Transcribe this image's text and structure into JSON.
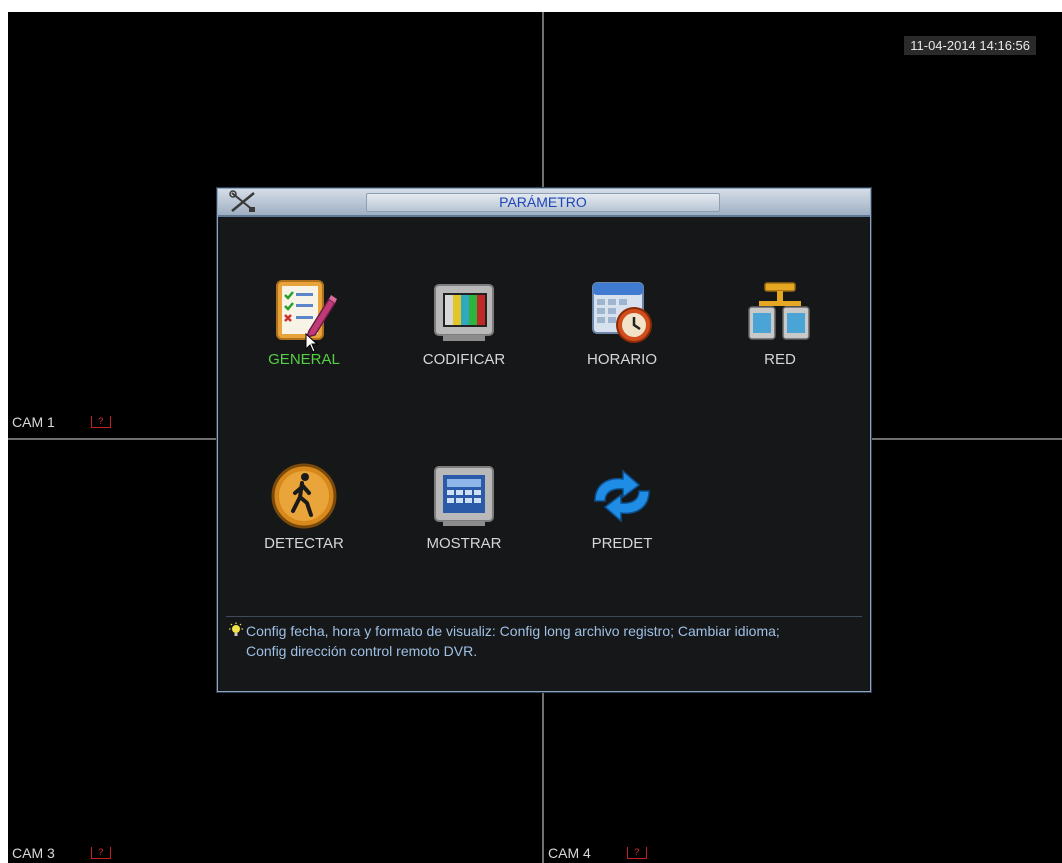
{
  "status": {
    "datetime": "11-04-2014 14:16:56"
  },
  "cameras": [
    {
      "label": "CAM 1",
      "rec": "?"
    },
    {
      "label": "CAM 3",
      "rec": "?"
    },
    {
      "label": "CAM 4",
      "rec": "?"
    }
  ],
  "dialog": {
    "title": "PARÁMETRO",
    "items": [
      {
        "label": "GENERAL",
        "icon": "general-checklist-icon",
        "active": true
      },
      {
        "label": "CODIFICAR",
        "icon": "encode-tv-icon"
      },
      {
        "label": "HORARIO",
        "icon": "schedule-calendar-clock-icon"
      },
      {
        "label": "RED",
        "icon": "network-icon"
      },
      {
        "label": "DETECTAR",
        "icon": "detect-person-icon"
      },
      {
        "label": "MOSTRAR",
        "icon": "display-monitor-icon"
      },
      {
        "label": "PREDET",
        "icon": "default-refresh-icon"
      }
    ],
    "hint_line1": "Config fecha, hora y formato de visualiz: Config long archivo registro; Cambiar idioma;",
    "hint_line2": "Config dirección control remoto DVR."
  },
  "colors": {
    "active_label": "#54d044",
    "title_text": "#1d45b8",
    "hint_text": "#9fc0e6"
  }
}
